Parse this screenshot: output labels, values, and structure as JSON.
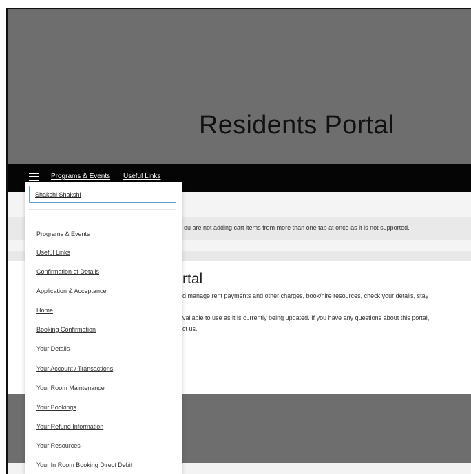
{
  "hero": {
    "title": "Residents Portal"
  },
  "nav": {
    "links": [
      "Programs & Events",
      "Useful Links"
    ]
  },
  "user_menu": {
    "name": "Shakshi Shakshi",
    "items": [
      "Programs & Events",
      "Useful Links",
      "Confirmation of Details",
      "Application & Acceptance",
      "Home",
      "Booking Confirmation",
      "Your Details",
      "Your Account / Transactions",
      "Your Room Maintenance",
      "Your Bookings",
      "Your Refund Information",
      "Your Resources",
      "Your In Room Booking Direct Debit"
    ]
  },
  "main": {
    "notice": "ou are not adding cart items from more than one tab at once as it is not supported.",
    "heading": "rtal",
    "lines": [
      "d manage rent payments and other charges, book/hire resources, check your details, stay",
      "vailable to use as it is currently being updated. If you have any questions about this portal,",
      "ct us."
    ]
  }
}
